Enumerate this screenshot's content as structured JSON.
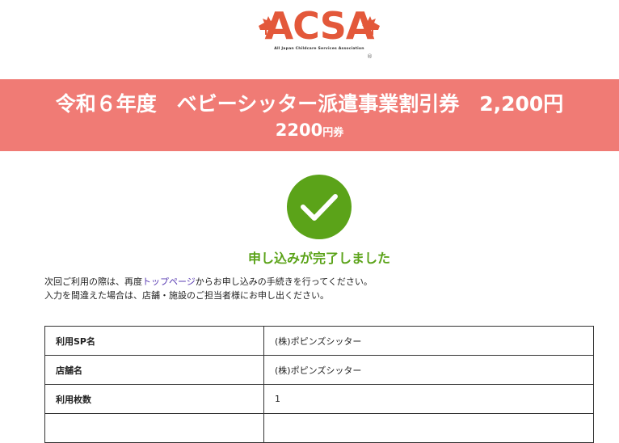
{
  "logo": {
    "text": "ACSA",
    "subtitle": "All Japan Childcare Services Association",
    "registered": "®",
    "leaf_icon": "maple-leaf-icon",
    "color": "#e3583a"
  },
  "banner": {
    "title": "令和６年度　ベビーシッター派遣事業割引券　2,200円",
    "amount": "2200",
    "unit": "円券",
    "background": "#f07b75"
  },
  "status": {
    "icon": "check-circle-icon",
    "icon_color": "#5ba319",
    "title": "申し込みが完了しました"
  },
  "message": {
    "line1_before": "次回ご利用の際は、再度",
    "line1_link": "トップページ",
    "line1_after": "からお申し込みの手続きを行ってください。",
    "line2": "入力を間違えた場合は、店舗・施設のご担当者様にお申し出ください。"
  },
  "details": {
    "rows": [
      {
        "label": "利用SP名",
        "value": "(株)ポピンズシッター"
      },
      {
        "label": "店舗名",
        "value": "(株)ポピンズシッター"
      },
      {
        "label": "利用枚数",
        "value": "1"
      },
      {
        "label": "",
        "value": ""
      }
    ]
  }
}
